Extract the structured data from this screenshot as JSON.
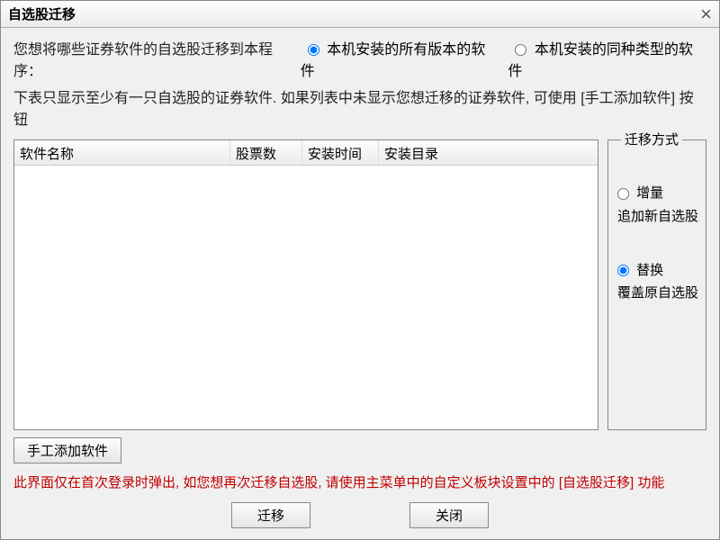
{
  "title": "自选股迁移",
  "line1": {
    "question": "您想将哪些证券软件的自选股迁移到本程序：",
    "opt_all": "本机安装的所有版本的软件",
    "opt_same": "本机安装的同种类型的软件"
  },
  "line2": "下表只显示至少有一只自选股的证券软件. 如果列表中未显示您想迁移的证券软件, 可使用 [手工添加软件] 按钮",
  "table": {
    "headers": [
      "软件名称",
      "股票数",
      "安装时间",
      "安装目录"
    ],
    "rows": []
  },
  "migrate_mode": {
    "legend": "迁移方式",
    "incremental": {
      "label": "增量",
      "desc": "追加新自选股"
    },
    "replace": {
      "label": "替换",
      "desc": "覆盖原自选股"
    }
  },
  "buttons": {
    "manual_add": "手工添加软件",
    "migrate": "迁移",
    "close": "关闭"
  },
  "red_hint": "此界面仅在首次登录时弹出, 如您想再次迁移自选股, 请使用主菜单中的自定义板块设置中的 [自选股迁移] 功能"
}
